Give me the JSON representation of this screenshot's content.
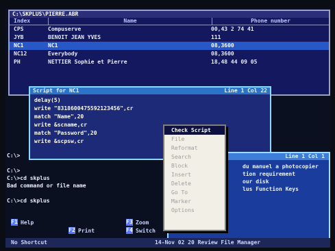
{
  "phone_window": {
    "title": "C:\\SKPLUS\\PIERRE.ABR",
    "headers": {
      "index": "Index",
      "name": "Name",
      "phone": "Phone number"
    },
    "rows": [
      {
        "index": "CPS",
        "name": "Compuserve",
        "phone": "00,43 2 74 41"
      },
      {
        "index": "JYB",
        "name": "BENOIT JEAN YVES",
        "phone": "111"
      },
      {
        "index": "NC1",
        "name": "NC1",
        "phone": "08,3600"
      },
      {
        "index": "NC12",
        "name": "Everybody",
        "phone": "08,3600"
      },
      {
        "index": "PH",
        "name": "NETTIER Sophie et Pierre",
        "phone": "18,48 44 09 05"
      }
    ]
  },
  "script_window": {
    "title": "Script for NC1",
    "position": "Line 1 Col 22",
    "lines": [
      "delay(5)",
      "write \"8318600475592123456\",cr",
      "match \"Name\",20",
      "write &scname,cr",
      "match \"Password\",20",
      "write &scpsw,cr"
    ]
  },
  "manual_window": {
    "title": "Line 1 Col 1",
    "lines": [
      "du manuel a photocopier",
      "",
      "",
      "tion requirement",
      "our disk",
      "lus Function Keys"
    ]
  },
  "terminal_lines": [
    "C:\\>",
    "",
    "C:\\>",
    "C:\\>cd skplus",
    "Bad command or file name",
    "",
    "C:\\>cd skplus"
  ],
  "function_keys": [
    {
      "key": "F1",
      "label": "Help"
    },
    {
      "key": "F2",
      "label": "Print"
    },
    {
      "key": "F3",
      "label": "Zoom"
    },
    {
      "key": "F4",
      "label": "Switch"
    }
  ],
  "status_bar": {
    "left": "No Shortcut",
    "right": "14-Nov 02   20 Review File Manager"
  },
  "context_menu": {
    "items": [
      "Check Script",
      "File",
      "Reformat",
      "Search",
      "Block",
      "Insert",
      "Delete",
      "Go To",
      "Marker",
      "Options"
    ],
    "active_item": "Check Script"
  }
}
